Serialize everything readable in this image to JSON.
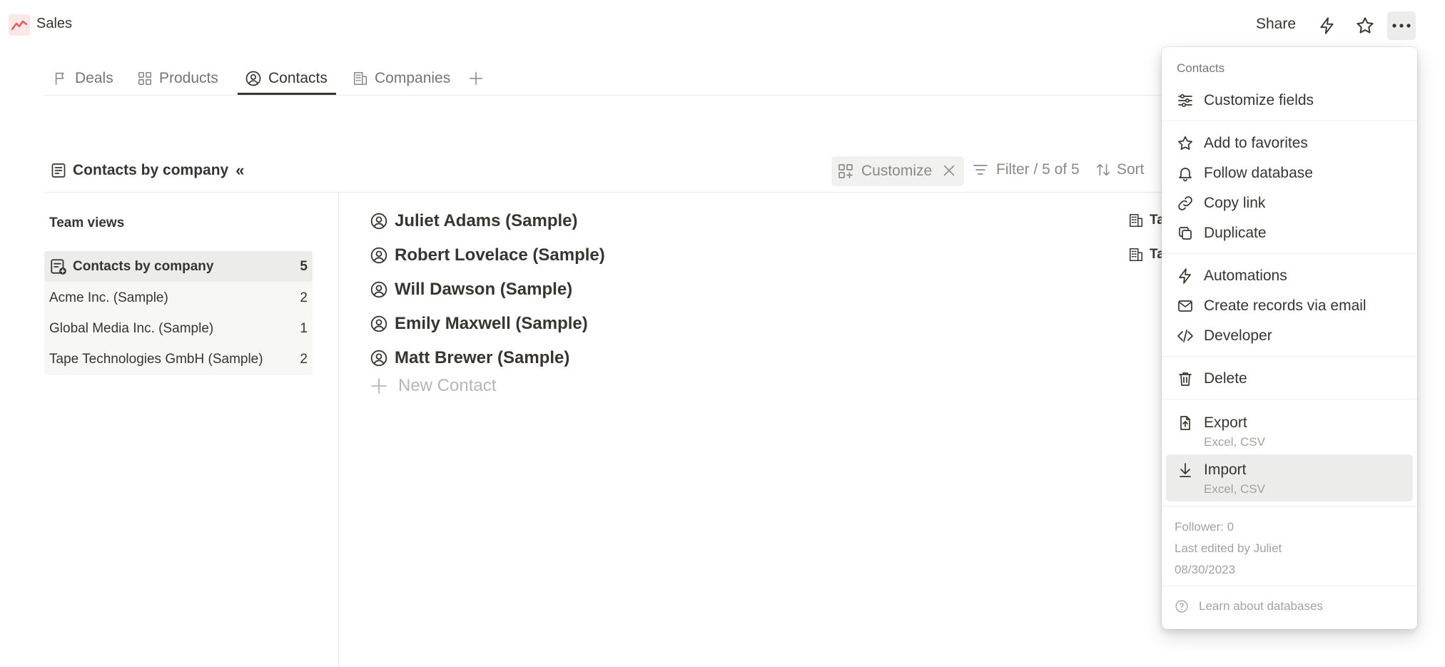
{
  "app": {
    "title": "Sales",
    "share_label": "Share"
  },
  "tabs": [
    {
      "label": "Deals",
      "icon": "flag-icon"
    },
    {
      "label": "Products",
      "icon": "gallery-icon"
    },
    {
      "label": "Contacts",
      "icon": "person-circle-icon",
      "active": true
    },
    {
      "label": "Companies",
      "icon": "building-icon"
    }
  ],
  "toolbar": {
    "view_title": "Contacts by company",
    "customize_label": "Customize",
    "filter_label": "Filter / 5 of 5",
    "sort_label": "Sort"
  },
  "sidebar": {
    "heading": "Team views",
    "views": [
      {
        "label": "Contacts by company",
        "count": "5"
      },
      {
        "label": "Acme Inc. (Sample)",
        "count": "2"
      },
      {
        "label": "Global Media Inc. (Sample)",
        "count": "1"
      },
      {
        "label": "Tape Technologies GmbH (Sample)",
        "count": "2"
      }
    ]
  },
  "contacts": [
    "Juliet Adams (Sample)",
    "Robert Lovelace (Sample)",
    "Will Dawson (Sample)",
    "Emily Maxwell (Sample)",
    "Matt Brewer (Sample)"
  ],
  "new_contact_label": "New Contact",
  "company_cells": [
    "Ta",
    "Ta"
  ],
  "menu": {
    "heading": "Contacts",
    "items": {
      "customize_fields": "Customize fields",
      "add_favorites": "Add to favorites",
      "follow_database": "Follow database",
      "copy_link": "Copy link",
      "duplicate": "Duplicate",
      "automations": "Automations",
      "create_via_email": "Create records via email",
      "developer": "Developer",
      "delete": "Delete",
      "export": "Export",
      "export_sub": "Excel, CSV",
      "import": "Import",
      "import_sub": "Excel, CSV"
    },
    "follower": "Follower: 0",
    "last_edited": "Last edited by Juliet",
    "date": "08/30/2023",
    "learn": "Learn about databases"
  },
  "colors": {
    "accent_logo": "#eb5757",
    "text": "#37352f",
    "muted": "#8a8985"
  }
}
